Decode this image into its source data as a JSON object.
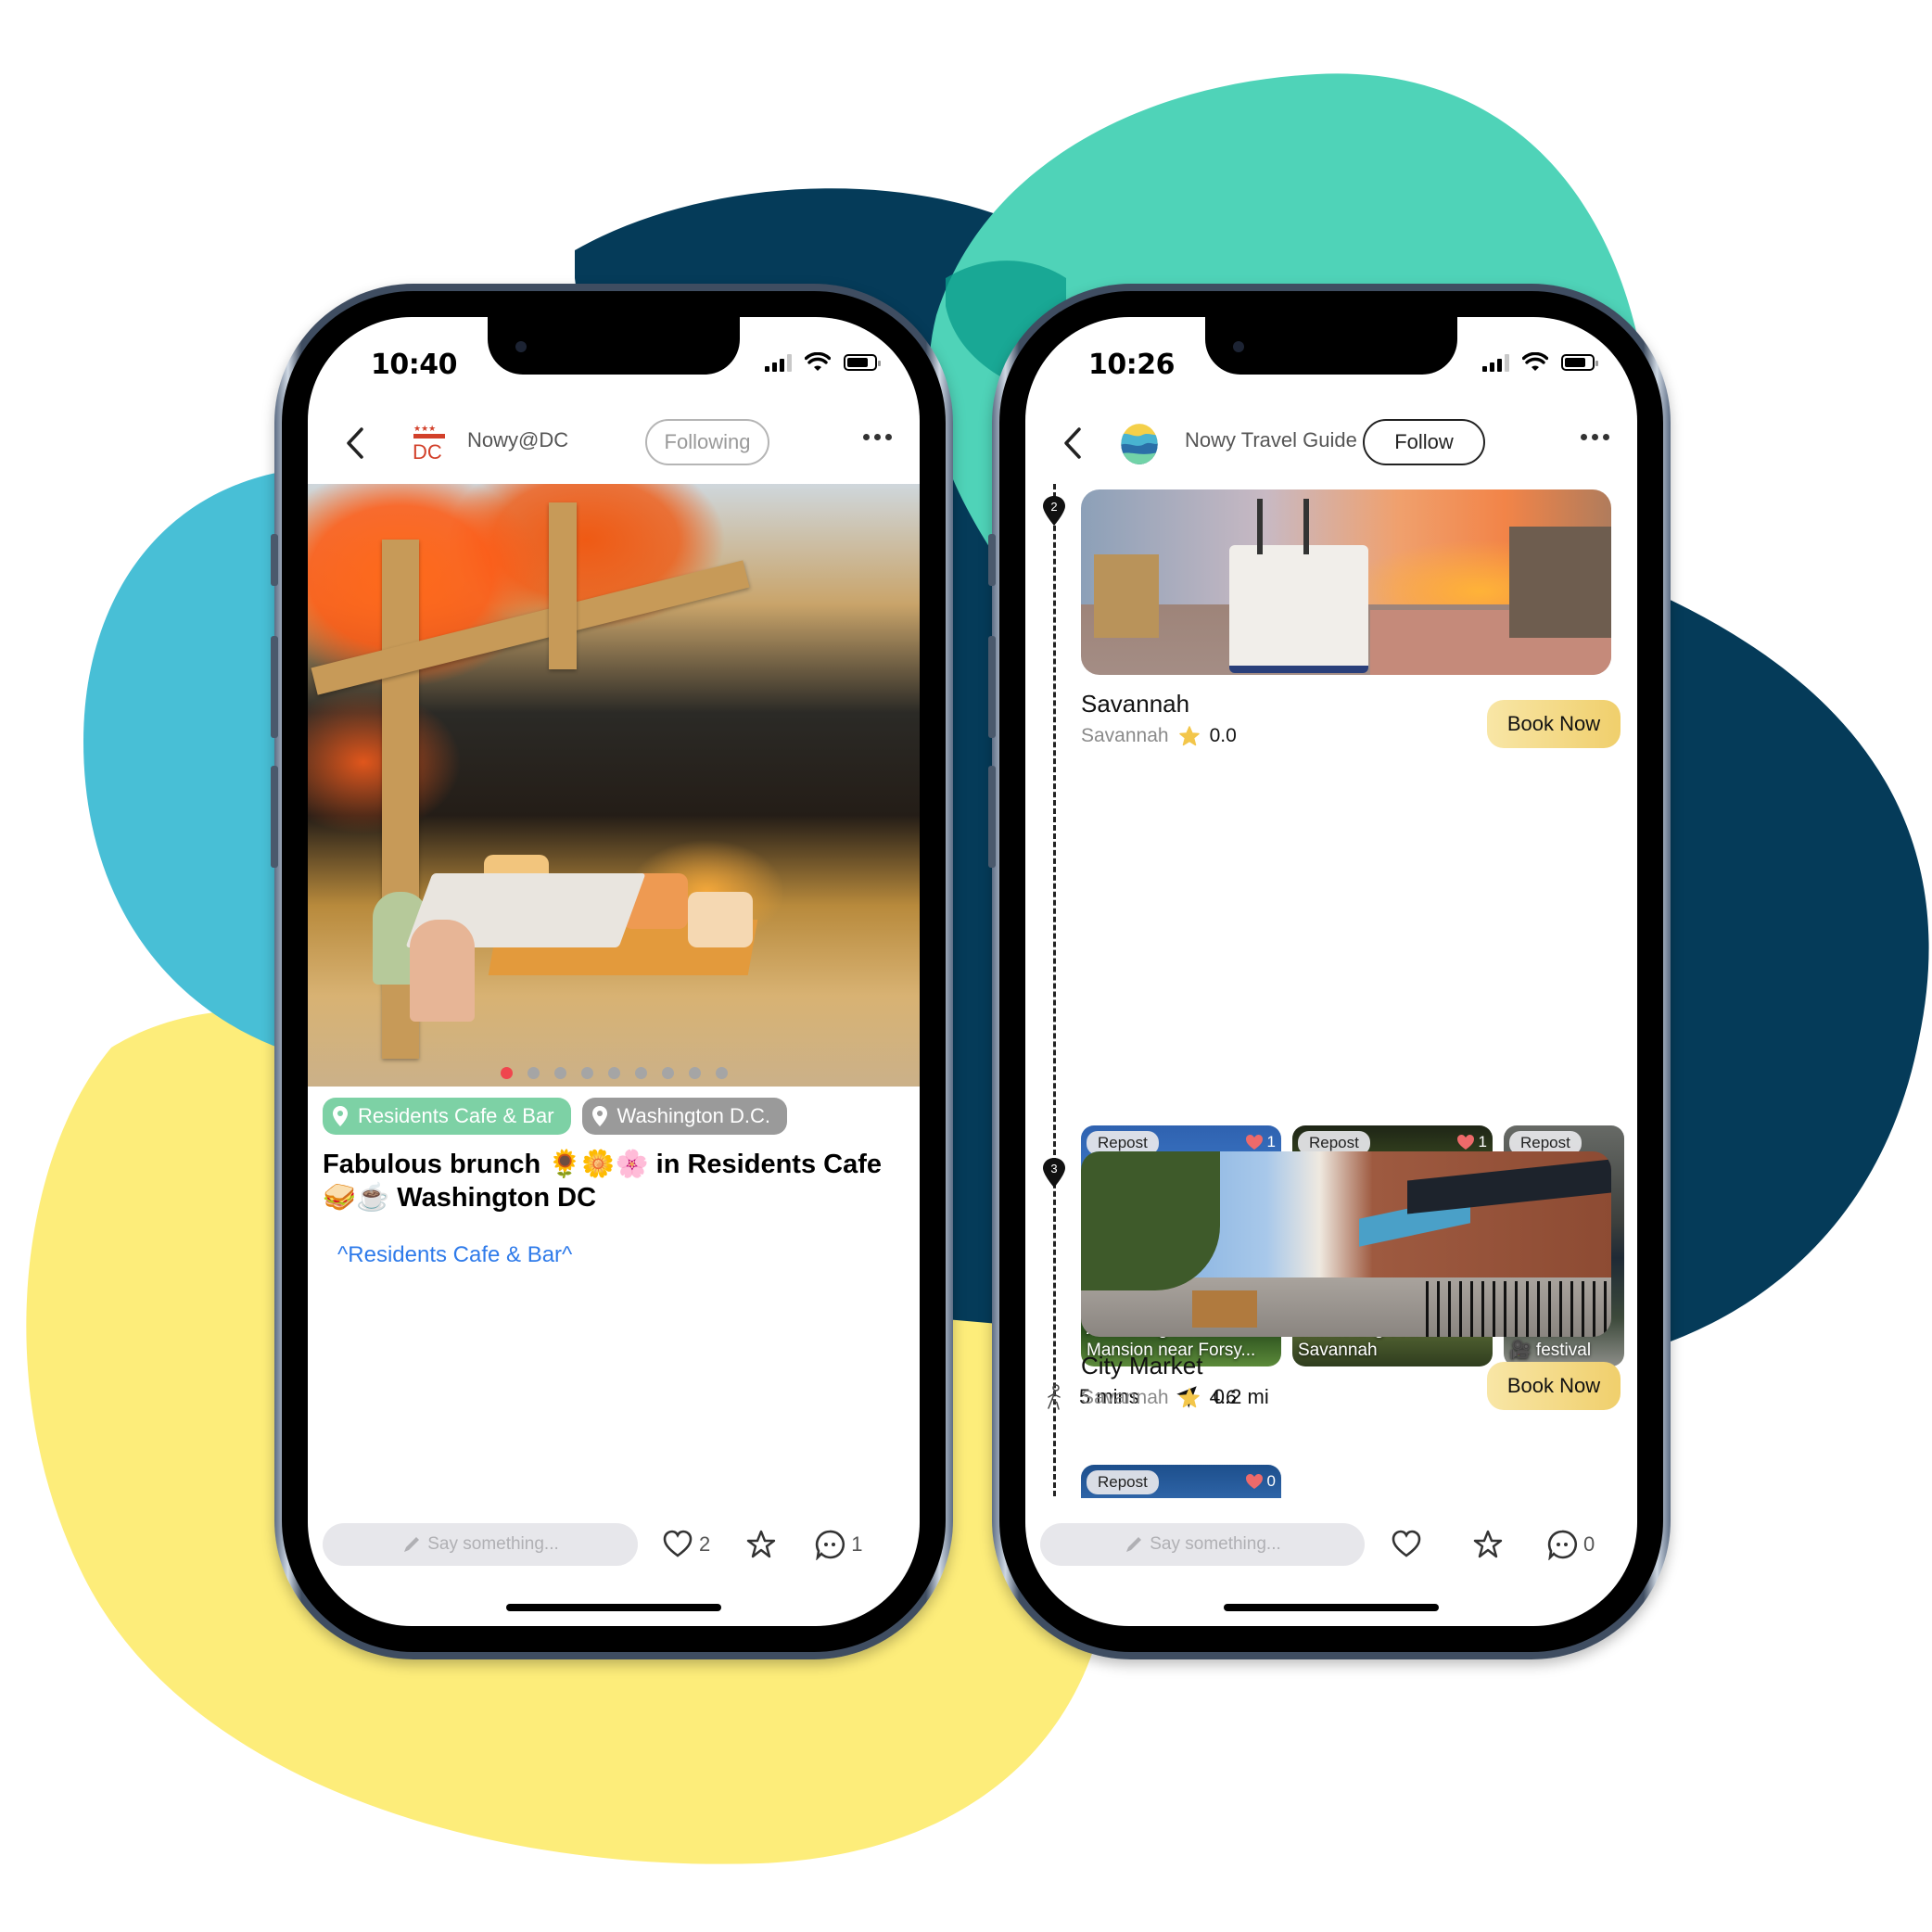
{
  "colors": {
    "blob_dark_navy": "#053b59",
    "blob_teal": "#4fd3b8",
    "blob_sky": "#48bfd6",
    "blob_yellow": "#fded7a",
    "follow_tag_green": "#7dd1a5",
    "location_tag_gray": "#9a9a9a",
    "link_blue": "#2f7bea",
    "book_gold": "#f0cf6c",
    "like_red": "#f0464e"
  },
  "left_phone": {
    "status": {
      "time": "10:40"
    },
    "header": {
      "back_icon": "chevron-left-icon",
      "account_logo": "washington-dc-logo",
      "account_name": "Nowy@DC",
      "follow_label": "Following",
      "more_icon": "ellipsis-icon"
    },
    "carousel": {
      "total": 9,
      "active_index": 0
    },
    "tags": [
      {
        "label": "Residents Cafe & Bar",
        "icon": "location-pin-icon"
      },
      {
        "label": "Washington D.C.",
        "icon": "location-pin-icon"
      }
    ],
    "post": {
      "title": "Fabulous brunch 🌻🌼🌸 in Residents Cafe 🥪☕ Washington DC",
      "link": "^Residents Cafe & Bar^"
    },
    "bottom_bar": {
      "placeholder": "Say something...",
      "likes": "2",
      "comments": "1"
    }
  },
  "right_phone": {
    "status": {
      "time": "10:26"
    },
    "header": {
      "back_icon": "chevron-left-icon",
      "account_logo": "nowy-travel-guide-logo",
      "account_name": "Nowy Travel Guide",
      "follow_label": "Follow",
      "more_icon": "ellipsis-icon"
    },
    "stops": [
      {
        "number": "2",
        "name": "Savannah",
        "city": "Savannah",
        "rating": "0.0",
        "button": "Book Now",
        "reposts": [
          {
            "badge": "Repost",
            "likes": "1",
            "caption": "Armstrong Kessler Mansion near Forsy..."
          },
          {
            "badge": "Repost",
            "likes": "1",
            "caption": "enchanting soul of Savannah"
          },
          {
            "badge": "Repost",
            "likes": "",
            "caption": "SCAD Film 🎥 festival"
          }
        ]
      },
      {
        "number": "3",
        "name": "City Market",
        "city": "Savannah",
        "rating": "4.6",
        "button": "Book Now",
        "reposts": [
          {
            "badge": "Repost",
            "likes": "0",
            "caption": ""
          }
        ]
      }
    ],
    "transit": {
      "walk_time": "5 mins",
      "distance": "0.2 mi"
    },
    "bottom_bar": {
      "placeholder": "Say something...",
      "likes": "",
      "comments": "0"
    }
  }
}
